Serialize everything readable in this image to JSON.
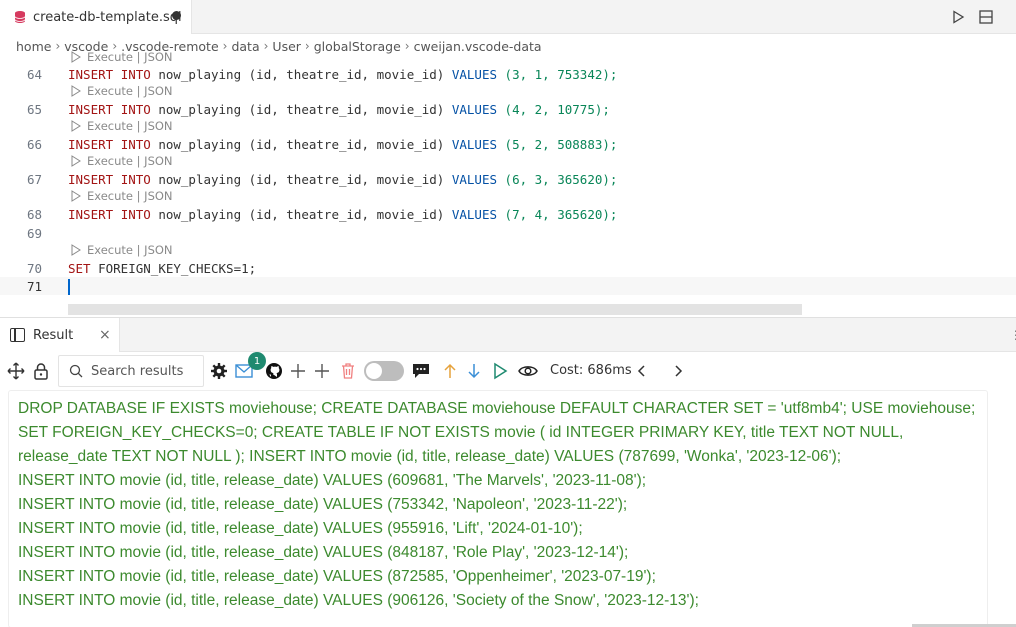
{
  "editor_tab": {
    "filename": "create-db-template.sql"
  },
  "breadcrumb": [
    "home",
    "vscode",
    ".vscode-remote",
    "data",
    "User",
    "globalStorage",
    "cweijan.vscode-data"
  ],
  "codelens_label": "Execute | JSON",
  "code_lines": [
    {
      "num": "64",
      "values": "(3, 1, 753342);"
    },
    {
      "num": "65",
      "values": "(4, 2, 10775);"
    },
    {
      "num": "66",
      "values": "(5, 2, 508883);"
    },
    {
      "num": "67",
      "values": "(6, 3, 365620);"
    },
    {
      "num": "68",
      "values": "(7, 4, 365620);"
    }
  ],
  "code_tokens": {
    "insert": "INSERT",
    "into": "INTO",
    "table": "now_playing",
    "columns": "(id, theatre_id, movie_id)",
    "values_kw": "VALUES"
  },
  "line69": {
    "num": "69"
  },
  "line70": {
    "num": "70",
    "kw": "SET",
    "text": "FOREIGN_KEY_CHECKS=1;"
  },
  "line71": {
    "num": "71"
  },
  "panel": {
    "tab_label": "Result",
    "close": "×",
    "search_placeholder": "Search results",
    "badge_count": "1",
    "cost_label": "Cost: 686ms"
  },
  "result_rows": [
    "DROP DATABASE IF EXISTS moviehouse; CREATE DATABASE moviehouse DEFAULT CHARACTER SET = 'utf8mb4'; USE moviehouse;",
    "SET FOREIGN_KEY_CHECKS=0; CREATE TABLE IF NOT EXISTS movie ( id INTEGER PRIMARY KEY,  title TEXT NOT NULL,",
    "release_date TEXT NOT NULL ); INSERT INTO movie (id, title, release_date) VALUES (787699, 'Wonka', '2023-12-06');",
    "INSERT INTO movie (id, title, release_date) VALUES (609681, 'The Marvels', '2023-11-08');",
    "INSERT INTO movie (id, title, release_date) VALUES (753342, 'Napoleon', '2023-11-22');",
    "INSERT INTO movie (id, title, release_date) VALUES (955916, 'Lift', '2024-01-10');",
    "INSERT INTO movie (id, title, release_date) VALUES (848187, 'Role Play', '2023-12-14');",
    "INSERT INTO movie (id, title, release_date) VALUES (872585, 'Oppenheimer', '2023-07-19');",
    "INSERT INTO movie (id, title, release_date) VALUES (906126, 'Society of the Snow', '2023-12-13');"
  ],
  "colors": {
    "keyword": "#a31515",
    "blue_keyword": "#0451a5",
    "number": "#098658",
    "result_text": "#3c8a2e",
    "badge": "#1f8a70"
  },
  "icons": [
    "database-icon",
    "run-icon",
    "split-editor-icon",
    "move-icon",
    "lock-icon",
    "search-icon",
    "gear-icon",
    "mail-icon",
    "github-icon",
    "plus-icon",
    "trash-icon",
    "toggle-switch",
    "comment-icon",
    "arrow-up-icon",
    "arrow-down-icon",
    "play-icon",
    "eye-icon",
    "chevron-left-icon",
    "chevron-right-icon"
  ]
}
